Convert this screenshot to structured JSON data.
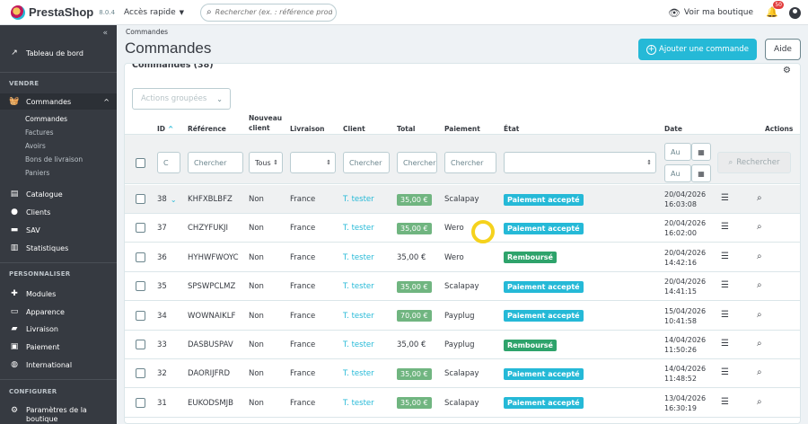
{
  "topbar": {
    "brand": "PrestaShop",
    "version": "8.0.4",
    "quick_access": "Accès rapide",
    "search_placeholder": "Rechercher (ex. : référence produit, no",
    "view_shop": "Voir ma boutique",
    "notif_count": "50"
  },
  "sidebar": {
    "dashboard": "Tableau de bord",
    "sections": {
      "sell": "VENDRE",
      "customize": "PERSONNALISER",
      "configure": "CONFIGURER"
    },
    "orders": "Commandes",
    "orders_sub": [
      "Commandes",
      "Factures",
      "Avoirs",
      "Bons de livraison",
      "Paniers"
    ],
    "sell_items": [
      "Catalogue",
      "Clients",
      "SAV",
      "Statistiques"
    ],
    "customize_items": [
      "Modules",
      "Apparence",
      "Livraison",
      "Paiement",
      "International"
    ],
    "configure_items": [
      "Paramètres de la",
      "boutique"
    ]
  },
  "header": {
    "breadcrumb": "Commandes",
    "title": "Commandes",
    "add_button": "Ajouter une commande",
    "help_button": "Aide"
  },
  "card": {
    "title": "Commandes (38)",
    "bulk_actions": "Actions groupées",
    "columns": {
      "id": "ID",
      "reference": "Référence",
      "new_client_1": "Nouveau",
      "new_client_2": "client",
      "delivery": "Livraison",
      "client": "Client",
      "total": "Total",
      "payment": "Paiement",
      "state": "État",
      "date": "Date",
      "actions": "Actions"
    },
    "filters": {
      "id": "C",
      "reference": "Chercher",
      "new_client": "Tous",
      "client": "Chercher",
      "total": "Chercher",
      "payment": "Chercher",
      "date_from": "Au",
      "date_to": "Au",
      "search_button": "Rechercher"
    }
  },
  "orders": [
    {
      "id": "38",
      "ref": "KHFXBLBFZ",
      "new": "Non",
      "country": "France",
      "client": "T. tester",
      "total": "35,00 €",
      "total_badge": true,
      "payment": "Scalapay",
      "state": "Paiement accepté",
      "state_color": "#25b9d7",
      "date": "20/04/2026",
      "time": "16:03:08"
    },
    {
      "id": "37",
      "ref": "CHZYFUKJI",
      "new": "Non",
      "country": "France",
      "client": "T. tester",
      "total": "35,00 €",
      "total_badge": true,
      "payment": "Wero",
      "state": "Paiement accepté",
      "state_color": "#25b9d7",
      "date": "20/04/2026",
      "time": "16:02:00"
    },
    {
      "id": "36",
      "ref": "HYHWFWOYC",
      "new": "Non",
      "country": "France",
      "client": "T. tester",
      "total": "35,00 €",
      "total_badge": false,
      "payment": "Wero",
      "state": "Remboursé",
      "state_color": "#2ea36b",
      "date": "20/04/2026",
      "time": "14:42:16"
    },
    {
      "id": "35",
      "ref": "SPSWPCLMZ",
      "new": "Non",
      "country": "France",
      "client": "T. tester",
      "total": "35,00 €",
      "total_badge": true,
      "payment": "Scalapay",
      "state": "Paiement accepté",
      "state_color": "#25b9d7",
      "date": "20/04/2026",
      "time": "14:41:15"
    },
    {
      "id": "34",
      "ref": "WOWNAIKLF",
      "new": "Non",
      "country": "France",
      "client": "T. tester",
      "total": "70,00 €",
      "total_badge": true,
      "payment": "Payplug",
      "state": "Paiement accepté",
      "state_color": "#25b9d7",
      "date": "15/04/2026",
      "time": "10:41:58"
    },
    {
      "id": "33",
      "ref": "DASBUSPAV",
      "new": "Non",
      "country": "France",
      "client": "T. tester",
      "total": "35,00 €",
      "total_badge": false,
      "payment": "Payplug",
      "state": "Remboursé",
      "state_color": "#2ea36b",
      "date": "14/04/2026",
      "time": "11:50:26"
    },
    {
      "id": "32",
      "ref": "DAORIJFRD",
      "new": "Non",
      "country": "France",
      "client": "T. tester",
      "total": "35,00 €",
      "total_badge": true,
      "payment": "Scalapay",
      "state": "Paiement accepté",
      "state_color": "#25b9d7",
      "date": "14/04/2026",
      "time": "11:48:52"
    },
    {
      "id": "31",
      "ref": "EUKODSMJB",
      "new": "Non",
      "country": "France",
      "client": "T. tester",
      "total": "35,00 €",
      "total_badge": true,
      "payment": "Scalapay",
      "state": "Paiement accepté",
      "state_color": "#25b9d7",
      "date": "13/04/2026",
      "time": "16:30:19"
    }
  ]
}
